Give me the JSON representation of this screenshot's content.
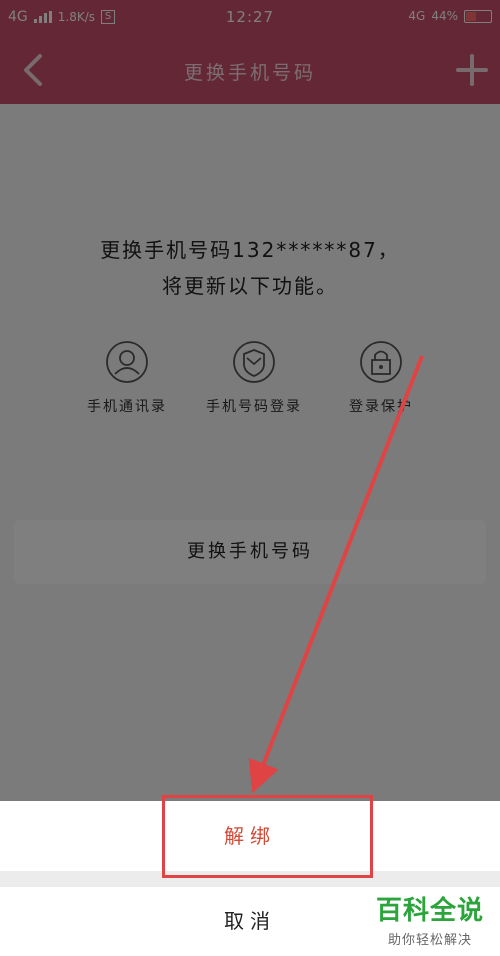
{
  "status_bar": {
    "network": "4G",
    "speed": "1.8K/s",
    "sim_icon": "S",
    "time": "12:27",
    "network_right": "4G",
    "battery": "44%"
  },
  "nav": {
    "title": "更换手机号码"
  },
  "content": {
    "desc_line1": "更换手机号码132******87，",
    "desc_line2": "将更新以下功能。",
    "features": [
      {
        "label": "手机通讯录",
        "icon": "contact-icon"
      },
      {
        "label": "手机号码登录",
        "icon": "shield-icon"
      },
      {
        "label": "登录保护",
        "icon": "lock-icon"
      }
    ],
    "change_button": "更换手机号码"
  },
  "sheet": {
    "unbind": "解绑",
    "cancel": "取消"
  },
  "watermark": {
    "title": "百科全说",
    "subtitle": "助你轻松解决"
  },
  "colors": {
    "header": "#c94f6b",
    "unbind_text": "#d24a35",
    "annotation": "#e04343",
    "watermark": "#2aa43b"
  }
}
